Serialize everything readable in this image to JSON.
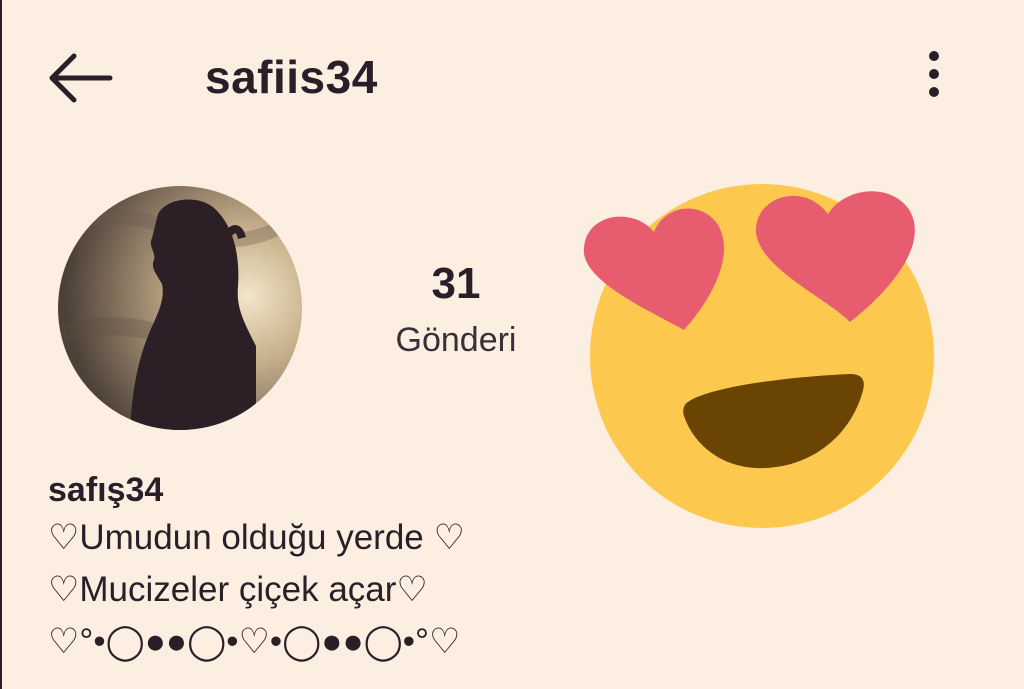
{
  "header": {
    "title": "safiis34",
    "back_icon": "arrow-left-icon",
    "more_icon": "vertical-dots-icon"
  },
  "profile": {
    "avatar_icon": "silhouette-profile-photo",
    "posts": {
      "count": "31",
      "label": "Gönderi"
    },
    "sticker_icon": "heart-eyes-emoji",
    "display_name": "safış34",
    "bio": [
      "♡Umudun olduğu yerde ♡",
      "♡Mucizeler çiçek açar♡",
      "♡°•◯●●◯•♡•◯●●◯•°♡"
    ]
  },
  "colors": {
    "background": "#fcefe2",
    "text": "#2a1f28",
    "emoji_face": "#fcc94e",
    "emoji_hearts": "#e85c70",
    "emoji_mouth": "#6a4402"
  }
}
